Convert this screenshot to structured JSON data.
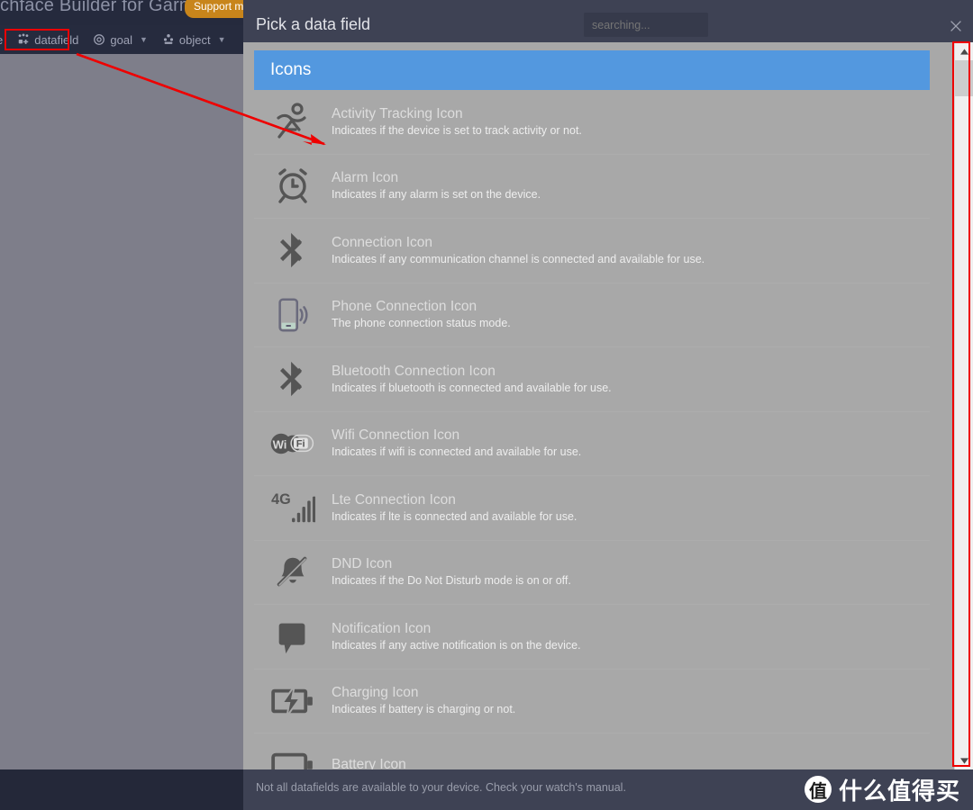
{
  "app": {
    "title": "chface Builder for Garmin",
    "support_badge": "Support my work",
    "toolbar": [
      {
        "label": "e",
        "icon": "cut-off-item",
        "caret": false,
        "cut": true
      },
      {
        "label": "datafield",
        "icon": "datafield-icon",
        "caret": false,
        "cut": false
      },
      {
        "label": "goal",
        "icon": "goal-icon",
        "caret": true,
        "cut": false
      },
      {
        "label": "object",
        "icon": "object-icon",
        "caret": true,
        "cut": false
      }
    ]
  },
  "modal": {
    "title": "Pick a data field",
    "search": {
      "value": "searching...",
      "placeholder": "searching..."
    },
    "close_label": "✕",
    "group_header": "Icons",
    "footer_note": "Not all datafields are available to your device. Check your watch's manual.",
    "items": [
      {
        "icon": "activity-tracking-icon",
        "title": "Activity Tracking Icon",
        "desc": "Indicates if the device is set to track activity or not."
      },
      {
        "icon": "alarm-icon",
        "title": "Alarm Icon",
        "desc": "Indicates if any alarm is set on the device."
      },
      {
        "icon": "connection-icon",
        "title": "Connection Icon",
        "desc": "Indicates if any communication channel is connected and available for use."
      },
      {
        "icon": "phone-connection-icon",
        "title": "Phone Connection Icon",
        "desc": "The phone connection status mode."
      },
      {
        "icon": "bluetooth-connection-icon",
        "title": "Bluetooth Connection Icon",
        "desc": "Indicates if bluetooth is connected and available for use."
      },
      {
        "icon": "wifi-connection-icon",
        "title": "Wifi Connection Icon",
        "desc": "Indicates if wifi is connected and available for use."
      },
      {
        "icon": "lte-connection-icon",
        "title": "Lte Connection Icon",
        "desc": "Indicates if lte is connected and available for use."
      },
      {
        "icon": "dnd-icon",
        "title": "DND Icon",
        "desc": "Indicates if the Do Not Disturb mode is on or off."
      },
      {
        "icon": "notification-icon",
        "title": "Notification Icon",
        "desc": "Indicates if any active notification is on the device."
      },
      {
        "icon": "charging-icon",
        "title": "Charging Icon",
        "desc": "Indicates if battery is charging or not."
      },
      {
        "icon": "battery-icon",
        "title": "Battery Icon",
        "desc": ""
      }
    ]
  },
  "scrollbar": {
    "up": "▲",
    "down": "▼"
  },
  "watermark": {
    "mark": "值",
    "text": "什么值得买"
  },
  "colors": {
    "accent_blue": "#5398df",
    "list_bg": "#a8a8a8",
    "modal_chrome": "#3e4254",
    "app_chrome": "#262b3e",
    "overlay": "#7e7e8a",
    "badge_orange": "#c8851b",
    "annotation_red": "#ee0000"
  }
}
